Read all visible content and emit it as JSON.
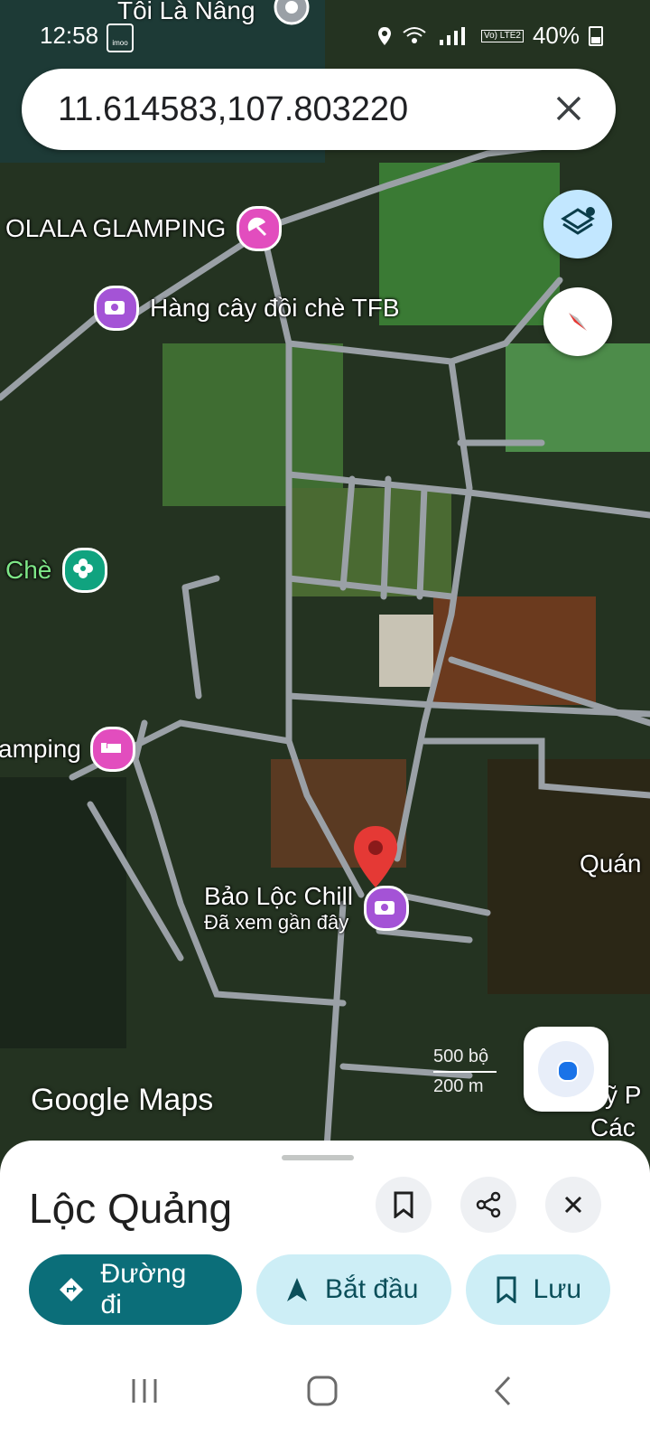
{
  "status": {
    "time": "12:58",
    "carrier_icon_text": "imoo",
    "lte_label": "Vo) LTE2",
    "battery": "40%"
  },
  "map": {
    "top_place": "Tôi Là Nâng",
    "pois": [
      {
        "label": "OLALA GLAMPING",
        "icon": "umbrella-icon",
        "color": "#e24dbe"
      },
      {
        "label": "Hàng cây đồi chè TFB",
        "icon": "camera-icon",
        "color": "#a453d6"
      },
      {
        "label": "Chè",
        "icon": "flower-icon",
        "color": "#10a37f"
      },
      {
        "label": "amping",
        "icon": "bed-icon",
        "color": "#e24dbe"
      },
      {
        "label": "Bảo Lộc Chill",
        "sub": "Đã xem gần đây",
        "icon": "camera-icon",
        "color": "#a453d6"
      }
    ],
    "edge_labels": {
      "right_1": "Quán",
      "right_2a": "ỹ P",
      "right_2b": "Các"
    },
    "scale": {
      "imperial": "500 bộ",
      "metric": "200 m"
    },
    "logo": "Google Maps"
  },
  "search": {
    "query": "11.614583,107.803220"
  },
  "sheet": {
    "title": "Lộc Quảng",
    "actions": {
      "directions": "Đường đi",
      "start": "Bắt đầu",
      "save": "Lưu"
    }
  },
  "colors": {
    "primary": "#0b6e79",
    "chip": "#cdeef6",
    "marker": "#e53935"
  }
}
